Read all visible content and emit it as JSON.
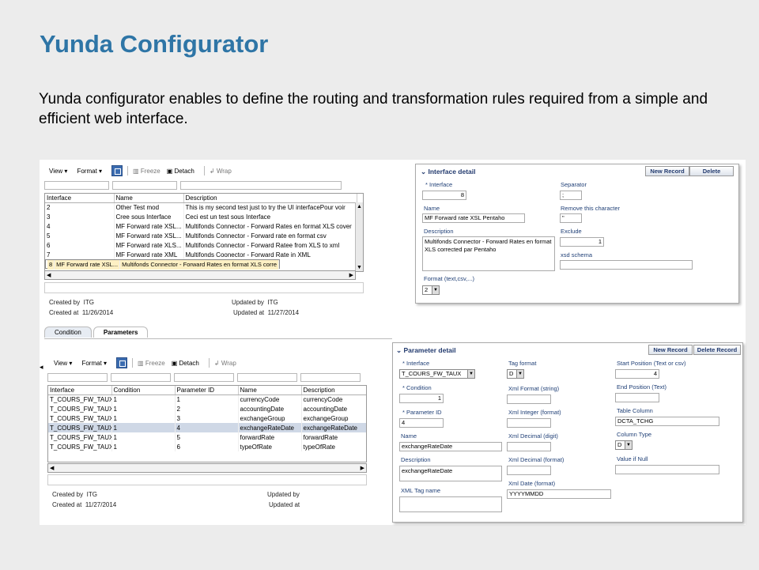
{
  "slide": {
    "title": "Yunda Configurator",
    "text": "Yunda configurator enables to define the routing and transformation rules required from a simple and efficient web interface."
  },
  "toolbar": {
    "view": "View",
    "format": "Format",
    "freeze": "Freeze",
    "detach": "Detach",
    "wrap": "Wrap"
  },
  "interfaces_table": {
    "headers": [
      "Interface",
      "Name",
      "Description"
    ],
    "rows": [
      [
        "2",
        "Other Test mod",
        "This is my second test just to try the UI interfacePour voir"
      ],
      [
        "3",
        "Cree sous Interface",
        "Ceci est un test sous Interface"
      ],
      [
        "4",
        "MF Forward rate XSL...",
        "Multifonds Connector - Forward Rates en format XLS cover"
      ],
      [
        "5",
        "MF Forward rate XSL...",
        "Multifonds Connector - Forward rate en format csv"
      ],
      [
        "6",
        "MF Forward rate XLS...",
        "Multifonds Connector - Forward Ratee from XLS to xml"
      ],
      [
        "7",
        "MF Forward rate XML",
        "Multifonds Coonector - Forward Rate in XML"
      ],
      [
        "8",
        "MF Forward rate XSL...",
        "Multifonds Connector - Forward Rates en format XLS corre"
      ]
    ]
  },
  "interfaces_meta": {
    "created_by_label": "Created by",
    "created_by": "ITG",
    "created_at_label": "Created at",
    "created_at": "11/26/2014",
    "updated_by_label": "Updated by",
    "updated_by": "ITG",
    "updated_at_label": "Updated at",
    "updated_at": "11/27/2014"
  },
  "interface_detail": {
    "title": "Interface detail",
    "new_record": "New Record",
    "delete": "Delete",
    "interface_label": "* Interface",
    "interface_value": "8",
    "name_label": "Name",
    "name_value": "MF Forward rate XSL Pentaho",
    "description_label": "Description",
    "description_value": "Multifonds Connector - Forward Rates en format XLS corrected par Pentaho",
    "format_label": "Format (text,csv,...)",
    "format_value": "2",
    "separator_label": "Separator",
    "separator_value": ";",
    "remove_label": "Remove this character",
    "remove_value": "\"",
    "exclude_label": "Exclude",
    "exclude_value": "1",
    "xsd_label": "xsd schema",
    "xsd_value": ""
  },
  "tabs": [
    "Condition",
    "Parameters"
  ],
  "params_table": {
    "headers": [
      "Interface",
      "Condition",
      "Parameter ID",
      "Name",
      "Description"
    ],
    "rows": [
      [
        "T_COURS_FW_TAUX",
        "1",
        "1",
        "currencyCode",
        "currencyCode"
      ],
      [
        "T_COURS_FW_TAUX",
        "1",
        "2",
        "accountingDate",
        "accountingDate"
      ],
      [
        "T_COURS_FW_TAUX",
        "1",
        "3",
        "exchangeGroup",
        "exchangeGroup"
      ],
      [
        "T_COURS_FW_TAUX",
        "1",
        "4",
        "exchangeRateDate",
        "exchangeRateDate"
      ],
      [
        "T_COURS_FW_TAUX",
        "1",
        "5",
        "forwardRate",
        "forwardRate"
      ],
      [
        "T_COURS_FW_TAUX",
        "1",
        "6",
        "typeOfRate",
        "typeOfRate"
      ]
    ]
  },
  "params_meta": {
    "created_by_label": "Created by",
    "created_by": "ITG",
    "created_at_label": "Created at",
    "created_at": "11/27/2014",
    "updated_by_label": "Updated by",
    "updated_at_label": "Updated at"
  },
  "parameter_detail": {
    "title": "Parameter detail",
    "new_record": "New Record",
    "delete_record": "Delete Record",
    "interface_label": "* Interface",
    "interface_value": "T_COURS_FW_TAUX",
    "condition_label": "* Condition",
    "condition_value": "1",
    "param_id_label": "* Parameter ID",
    "param_id_value": "4",
    "name_label": "Name",
    "name_value": "exchangeRateDate",
    "description_label": "Description",
    "description_value": "exchangeRateDate",
    "xml_tag_label": "XML Tag name",
    "tag_format_label": "Tag format",
    "tag_format_value": "D",
    "xml_format_label": "Xml Format (string)",
    "xml_integer_label": "Xml Integer (format)",
    "xml_decimal_digit_label": "Xml Decimal (digit)",
    "xml_decimal_format_label": "Xml Decimal (format)",
    "xml_date_label": "Xml Date (format)",
    "xml_date_value": "YYYYMMDD",
    "start_pos_label": "Start Position (Text or csv)",
    "start_pos_value": "4",
    "end_pos_label": "End Position (Text)",
    "table_col_label": "Table Column",
    "table_col_value": "DCTA_TCHG",
    "col_type_label": "Column Type",
    "col_type_value": "D",
    "null_label": "Value if Null"
  }
}
